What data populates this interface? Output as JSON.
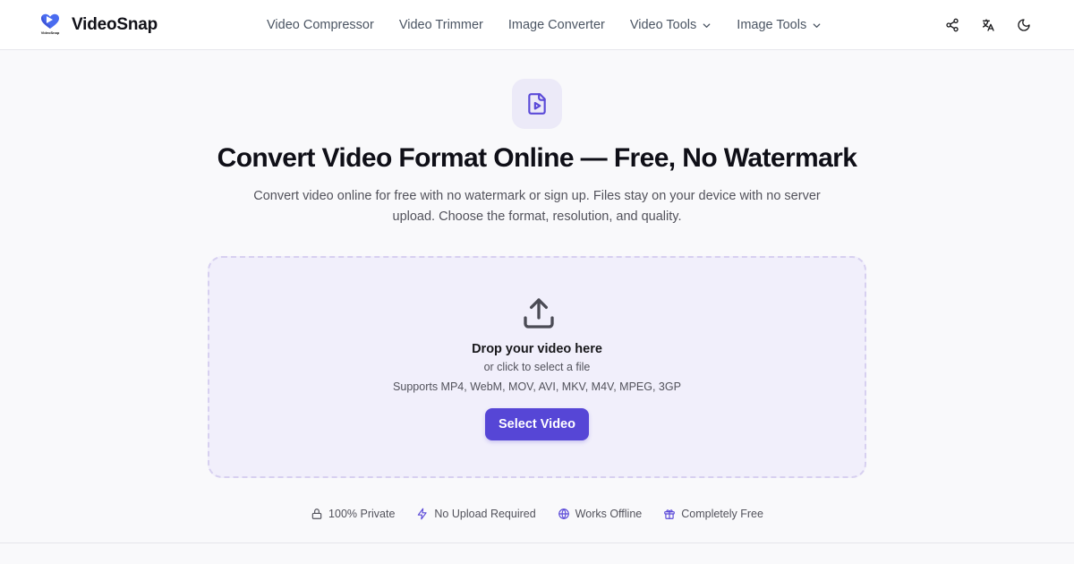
{
  "header": {
    "brand_name": "VideoSnap",
    "logo_caption": "VideoSnap",
    "nav": [
      {
        "label": "Video Compressor",
        "has_dropdown": false
      },
      {
        "label": "Video Trimmer",
        "has_dropdown": false
      },
      {
        "label": "Image Converter",
        "has_dropdown": false
      },
      {
        "label": "Video Tools",
        "has_dropdown": true
      },
      {
        "label": "Image Tools",
        "has_dropdown": true
      }
    ],
    "icons": [
      "share-icon",
      "translate-icon",
      "moon-icon"
    ]
  },
  "hero": {
    "icon": "video-file-icon",
    "title": "Convert Video Format Online — Free, No Watermark",
    "subtitle": "Convert video online for free with no watermark or sign up. Files stay on your device with no server upload. Choose the format, resolution, and quality."
  },
  "dropzone": {
    "icon": "upload-icon",
    "title": "Drop your video here",
    "subtitle": "or click to select a file",
    "formats": "Supports MP4, WebM, MOV, AVI, MKV, M4V, MPEG, 3GP",
    "button_label": "Select Video"
  },
  "features": [
    {
      "icon": "lock-icon",
      "label": "100% Private"
    },
    {
      "icon": "lightning-icon",
      "label": "No Upload Required"
    },
    {
      "icon": "globe-icon",
      "label": "Works Offline"
    },
    {
      "icon": "gift-icon",
      "label": "Completely Free"
    }
  ],
  "colors": {
    "accent": "#5646d6",
    "icon_accent": "#5b4ad8",
    "dropzone_bg": "#f1effb",
    "page_bg": "#f9f9fb"
  }
}
